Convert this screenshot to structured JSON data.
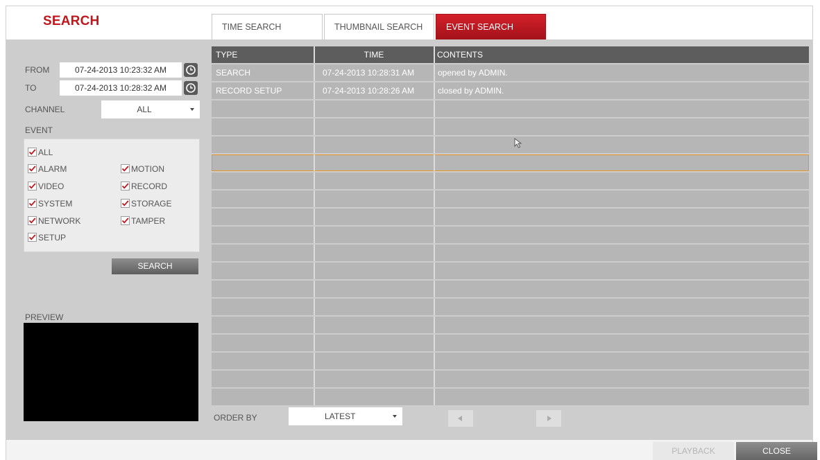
{
  "header": {
    "title": "SEARCH",
    "tabs": [
      {
        "label": "TIME SEARCH",
        "active": false
      },
      {
        "label": "THUMBNAIL SEARCH",
        "active": false
      },
      {
        "label": "EVENT SEARCH",
        "active": true
      }
    ]
  },
  "filters": {
    "from_label": "FROM",
    "from_value": "07-24-2013 10:23:32 AM",
    "to_label": "TO",
    "to_value": "07-24-2013 10:28:32 AM",
    "channel_label": "CHANNEL",
    "channel_value": "ALL",
    "event_label": "EVENT",
    "events": [
      {
        "label": "ALL",
        "checked": true
      },
      {
        "label": "ALARM",
        "checked": true
      },
      {
        "label": "MOTION",
        "checked": true
      },
      {
        "label": "VIDEO",
        "checked": true
      },
      {
        "label": "RECORD",
        "checked": true
      },
      {
        "label": "SYSTEM",
        "checked": true
      },
      {
        "label": "STORAGE",
        "checked": true
      },
      {
        "label": "NETWORK",
        "checked": true
      },
      {
        "label": "TAMPER",
        "checked": true
      },
      {
        "label": "SETUP",
        "checked": true
      }
    ],
    "search_button": "SEARCH",
    "preview_label": "PREVIEW"
  },
  "table": {
    "columns": [
      "TYPE",
      "TIME",
      "CONTENTS"
    ],
    "rows": [
      {
        "type": "SEARCH",
        "time": "07-24-2013  10:28:31 AM",
        "contents": "opened by ADMIN."
      },
      {
        "type": "RECORD SETUP",
        "time": "07-24-2013  10:28:26 AM",
        "contents": "closed by ADMIN."
      }
    ],
    "total_visible_rows": 19,
    "selected_row": 5
  },
  "footer": {
    "order_label": "ORDER BY",
    "order_value": "LATEST",
    "prev_icon": "triangle-left-icon",
    "next_icon": "triangle-right-icon",
    "playback_button": "PLAYBACK",
    "close_button": "CLOSE"
  },
  "colors": {
    "brand_red": "#c0171d",
    "highlight_outline": "#e8941f"
  }
}
